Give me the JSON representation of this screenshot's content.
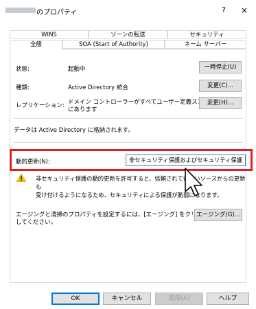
{
  "window": {
    "title": "のプロパティ",
    "help_label": "?",
    "close_label": "×"
  },
  "tabs_row1": [
    "WINS",
    "ゾーンの転送",
    "セキュリティ"
  ],
  "tabs_row2": [
    "全般",
    "SOA (Start of Authority)",
    "ネーム サーバー"
  ],
  "general": {
    "status_label": "状態:",
    "status_value": "起動中",
    "pause_button": "一時停止(U)",
    "type_label": "種類:",
    "type_value": "Active Directory 統合",
    "type_change_button": "変更(C)...",
    "replication_label": "レプリケーション:",
    "replication_value_line1": "ドメイン コントローラーがすべてユーザー定義スコープ",
    "replication_value_line2": "にあります",
    "replication_change_button": "変更(H)...",
    "stored_text": "データは Active Directory に格納されます。",
    "dynamic_update_label": "動的更新(N):",
    "dynamic_update_value": "非セキュリティ保護およびセキュリティ保護",
    "warning_line1": "非セキュリティ保護の動的更新を許可すると、信頼されていないソースからの更新も",
    "warning_line2": "受け付けるようになるため、セキュリティによる保護が脆弱になります。",
    "aging_text_line1": "エージングと清掃のプロパティを設定するには、[エージング] をクリック",
    "aging_text_line2": "してください。",
    "aging_button": "エージング(G)..."
  },
  "footer": {
    "ok": "OK",
    "cancel": "キャンセル",
    "apply": "適用(A)",
    "help": "ヘルプ"
  },
  "colors": {
    "highlight": "#e02020",
    "select_border": "#3c7fb1",
    "warning": "#f5c400"
  }
}
